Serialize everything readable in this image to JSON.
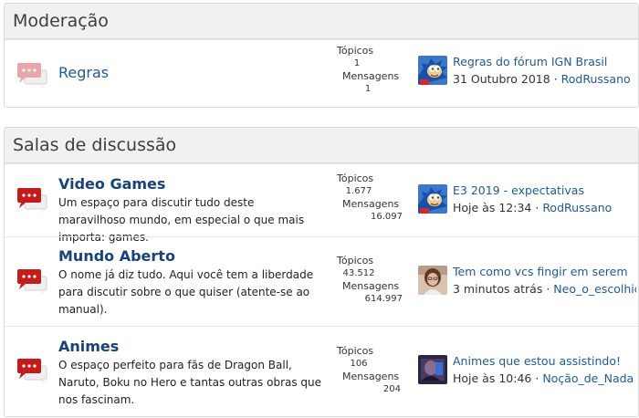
{
  "moderation": {
    "header": "Moderação",
    "forum": {
      "title": "Regras",
      "stats": {
        "threads_label": "Tópicos",
        "threads": "1",
        "messages_label": "Mensagens",
        "messages": "1"
      },
      "last_post": {
        "title": "Regras do fórum IGN Brasil",
        "date": "31 Outubro 2018",
        "separator": "·",
        "user": "RodRussano",
        "avatar_icon": "sonic-avatar-icon"
      }
    }
  },
  "discussion": {
    "header": "Salas de discussão",
    "forums": [
      {
        "title": "Video Games",
        "description": "Um espaço para discutir tudo deste maravilhoso mundo, em especial o que mais importa: games.",
        "stats": {
          "threads_label": "Tópicos",
          "threads": "1.677",
          "messages_label": "Mensagens",
          "messages": "16.097"
        },
        "last_post": {
          "title": "E3 2019 - expectativas",
          "date": "Hoje às 12:34",
          "separator": "·",
          "user": "RodRussano",
          "avatar_icon": "sonic-avatar-icon"
        }
      },
      {
        "title": "Mundo Aberto",
        "description": "O nome já diz tudo. Aqui você tem a liberdade para discutir sobre o que quiser (atente-se ao manual).",
        "stats": {
          "threads_label": "Tópicos",
          "threads": "43.512",
          "messages_label": "Mensagens",
          "messages": "614.997"
        },
        "last_post": {
          "title": "Tem como vcs fingir em serem",
          "date": "3 minutos atrás",
          "separator": "·",
          "user": "Neo_o_escolhido",
          "avatar_icon": "user-photo-avatar-icon"
        }
      },
      {
        "title": "Animes",
        "description": "O espaço perfeito para fãs de Dragon Ball, Naruto, Boku no Hero e tantas outras obras que nos fascinam.",
        "stats": {
          "threads_label": "Tópicos",
          "threads": "106",
          "messages_label": "Mensagens",
          "messages": "204"
        },
        "last_post": {
          "title": "Animes que estou assistindo!",
          "date": "Hoje às 10:46",
          "separator": "·",
          "user": "Noção_de_Nada",
          "avatar_icon": "dark-avatar-icon"
        }
      }
    ]
  },
  "colors": {
    "link": "#1e5a99",
    "title_bold": "#17427a",
    "icon_read": "#e8a6aa",
    "icon_unread": "#c41b1b",
    "header_bg": "#f1f1f1"
  }
}
